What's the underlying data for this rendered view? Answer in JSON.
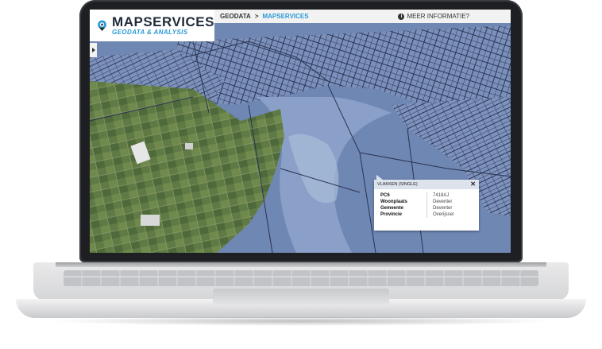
{
  "logo": {
    "title": "MAPSERVICES",
    "subtitle": "GEODATA & ANALYSIS"
  },
  "breadcrumb": {
    "root": "GEODATA",
    "separator": ">",
    "active": "MAPSERVICES"
  },
  "info": {
    "label": "MEER INFORMATIE?",
    "icon": "info-icon"
  },
  "popup": {
    "title": "VLAKKEN (SINGLE)",
    "close": "✕",
    "rows": [
      {
        "key": "PC6",
        "value": "7418AJ"
      },
      {
        "key": "Woonplaats",
        "value": "Deventer"
      },
      {
        "key": "Gemeente",
        "value": "Deventer"
      },
      {
        "key": "Provincie",
        "value": "Overijssel"
      }
    ]
  },
  "colors": {
    "accent": "#2a9bd6",
    "map_overlay": "#6f87b3",
    "logo_dark": "#1f2b3a"
  }
}
